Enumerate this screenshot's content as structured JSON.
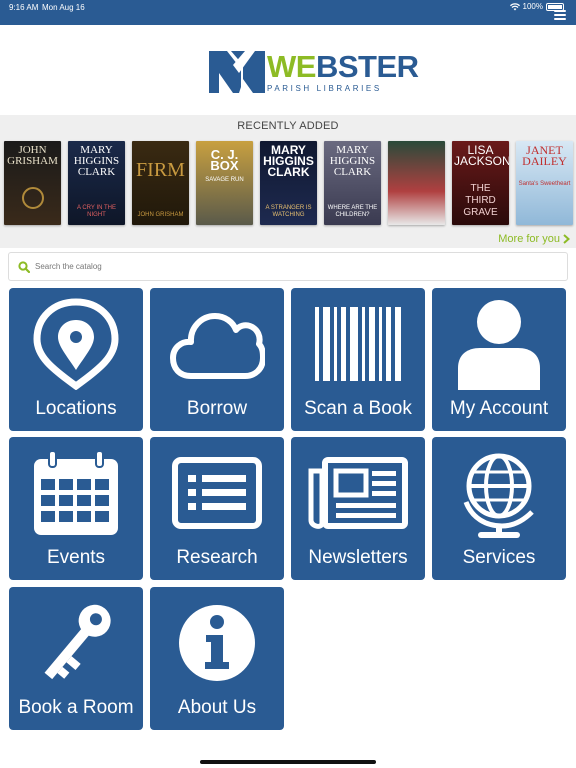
{
  "status": {
    "time": "9:16 AM",
    "date": "Mon Aug 16",
    "battery": "100%"
  },
  "colors": {
    "primary": "#2a5b93",
    "accent": "#8dbb25"
  },
  "logo": {
    "we": "WE",
    "bster": "BSTER",
    "subtitle": "PARISH LIBRARIES"
  },
  "recent": {
    "title": "RECENTLY ADDED",
    "more_label": "More for you",
    "covers": [
      {
        "author": "JOHN GRISHAM",
        "title": ""
      },
      {
        "author": "MARY HIGGINS CLARK",
        "title": "A CRY IN THE NIGHT"
      },
      {
        "author": "",
        "title": "JOHN GRISHAM"
      },
      {
        "author": "C. J. BOX",
        "title": "SAVAGE RUN"
      },
      {
        "author": "MARY HIGGINS CLARK",
        "title": "A STRANGER IS WATCHING"
      },
      {
        "author": "MARY HIGGINS CLARK",
        "title": "WHERE ARE THE CHILDREN?"
      },
      {
        "author": "",
        "title": ""
      },
      {
        "author": "LISA JACKSON",
        "title": "THE THIRD GRAVE"
      },
      {
        "author": "JANET DAILEY",
        "title": "Santa's Sweetheart"
      }
    ]
  },
  "search": {
    "placeholder": "Search the catalog"
  },
  "tiles": {
    "locations": "Locations",
    "borrow": "Borrow",
    "scan": "Scan a Book",
    "account": "My Account",
    "events": "Events",
    "research": "Research",
    "newsletters": "Newsletters",
    "services": "Services",
    "book_room": "Book a Room",
    "about": "About Us"
  },
  "icons": [
    "menu-icon",
    "wifi-icon",
    "battery-icon",
    "search-icon",
    "location-pin-icon",
    "cloud-icon",
    "barcode-icon",
    "person-icon",
    "calendar-icon",
    "list-card-icon",
    "newspaper-icon",
    "globe-icon",
    "key-icon",
    "info-icon",
    "chevron-right-icon"
  ]
}
